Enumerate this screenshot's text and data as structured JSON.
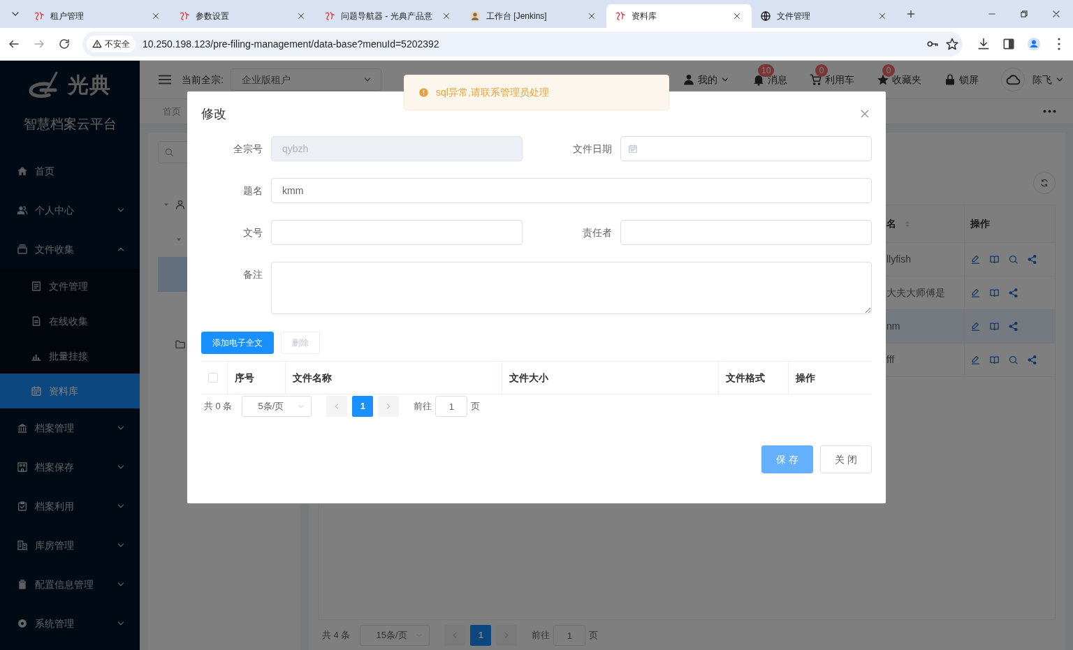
{
  "browser": {
    "tabs": [
      {
        "title": "租户管理",
        "selected": false
      },
      {
        "title": "参数设置",
        "selected": false
      },
      {
        "title": "问题导航器 - 光典产品意",
        "selected": false
      },
      {
        "title": "工作台 [Jenkins]",
        "selected": false
      },
      {
        "title": "资料库",
        "selected": true
      },
      {
        "title": "文件管理",
        "selected": false
      }
    ],
    "security_label": "不安全",
    "url": "10.250.198.123/pre-filing-management/data-base?menuId=5202392"
  },
  "sidebar": {
    "logo_text": "光典",
    "title": "智慧档案云平台",
    "menu": [
      {
        "label": "首页",
        "selected": false
      },
      {
        "label": "个人中心",
        "selected": false,
        "expanded": false
      },
      {
        "label": "文件收集",
        "selected": false,
        "expanded": true,
        "children": [
          {
            "label": "文件管理",
            "selected": false
          },
          {
            "label": "在线收集",
            "selected": false
          },
          {
            "label": "批量挂接",
            "selected": false
          },
          {
            "label": "资料库",
            "selected": true
          }
        ]
      },
      {
        "label": "档案管理",
        "selected": false,
        "expanded": false
      },
      {
        "label": "档案保存",
        "selected": false,
        "expanded": false
      },
      {
        "label": "档案利用",
        "selected": false,
        "expanded": false
      },
      {
        "label": "库房管理",
        "selected": false,
        "expanded": false
      },
      {
        "label": "配置信息管理",
        "selected": false,
        "expanded": false
      },
      {
        "label": "系统管理",
        "selected": false,
        "expanded": false
      }
    ]
  },
  "header": {
    "fonds_label": "当前全宗:",
    "fonds_value": "企业版租户",
    "actions": [
      {
        "label": "我的",
        "dropdown": true
      },
      {
        "label": "消息",
        "badge": "10"
      },
      {
        "label": "利用车",
        "badge": "0"
      },
      {
        "label": "收藏夹",
        "badge": "0"
      },
      {
        "label": "锁屏"
      }
    ],
    "user": {
      "name": "陈飞",
      "dropdown": true
    }
  },
  "page_tabs": [
    "首页"
  ],
  "tree": [
    {
      "kind": "user",
      "expanded": true,
      "selected": false,
      "children": [
        {
          "expanded": true,
          "selected": false,
          "children": [
            {
              "selected": true
            },
            {
              "selected": false
            }
          ]
        },
        {
          "kind": "folder",
          "selected": false
        }
      ]
    }
  ],
  "table": {
    "columns": [
      {
        "label": "名",
        "sortable": true
      },
      {
        "label": "操作",
        "sortable": false
      }
    ],
    "rows": [
      {
        "cells": [
          "llyfish"
        ],
        "selected": false,
        "actions": [
          {
            "kind": "edit"
          },
          {
            "kind": "book"
          },
          {
            "kind": "search"
          },
          {
            "kind": "share"
          }
        ]
      },
      {
        "cells": [
          "大夫大师傅是"
        ],
        "selected": false,
        "actions": [
          {
            "kind": "edit"
          },
          {
            "kind": "book"
          },
          {
            "kind": "share"
          }
        ]
      },
      {
        "cells": [
          "nm"
        ],
        "selected": true,
        "actions": [
          {
            "kind": "edit"
          },
          {
            "kind": "book"
          },
          {
            "kind": "share"
          }
        ]
      },
      {
        "cells": [
          "fff"
        ],
        "selected": false,
        "actions": [
          {
            "kind": "edit"
          },
          {
            "kind": "book"
          },
          {
            "kind": "search"
          },
          {
            "kind": "share"
          }
        ]
      }
    ],
    "pagination": {
      "total": "共 4 条",
      "page_size": "15条/页",
      "pages": [
        {
          "label": "1",
          "selected": true
        }
      ],
      "goto_label": "前往",
      "goto_value": "1",
      "page_suffix": "页"
    }
  },
  "modal": {
    "title": "修改",
    "fields": [
      {
        "label": "全宗号",
        "kind": "text",
        "value": "qybzh",
        "disabled": true
      },
      {
        "label": "文件日期",
        "kind": "date",
        "disabled": false
      },
      {
        "label": "题名",
        "kind": "wide_text",
        "value": "kmm",
        "disabled": false
      },
      {
        "label": "文号",
        "kind": "text",
        "disabled": false
      },
      {
        "label": "责任者",
        "kind": "text",
        "disabled": false
      },
      {
        "label": "备注",
        "kind": "textarea",
        "disabled": false
      }
    ],
    "buttons": [
      {
        "label": "添加电子全文",
        "kind": "primary",
        "disabled": false
      },
      {
        "label": "删除",
        "kind": "default",
        "disabled": true
      }
    ],
    "table": {
      "select_all_checked": false,
      "columns": [
        "序号",
        "文件名称",
        "文件大小",
        "文件格式",
        "操作"
      ]
    },
    "pagination": {
      "total": "共 0 条",
      "page_size": "5条/页",
      "pages": [
        {
          "label": "1",
          "selected": true
        }
      ],
      "goto_label": "前往",
      "goto_value": "1",
      "page_suffix": "页"
    },
    "footer": [
      {
        "label": "保 存",
        "kind": "primary"
      },
      {
        "label": "关 闭",
        "kind": "default"
      }
    ]
  },
  "toast": {
    "kind": "warning",
    "text": "sql异常,请联系管理员处理"
  }
}
